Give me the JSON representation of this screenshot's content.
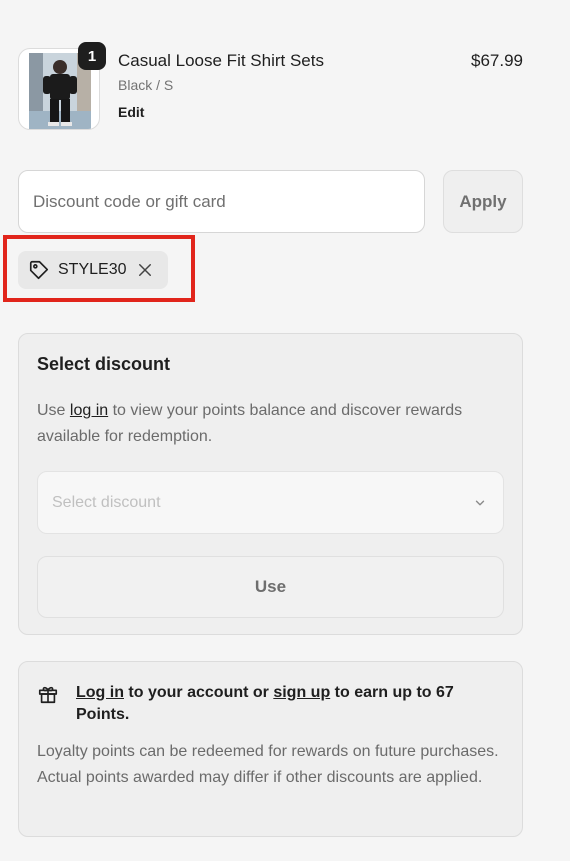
{
  "product": {
    "quantity": "1",
    "name": "Casual Loose Fit Shirt Sets",
    "variant": "Black / S",
    "edit_label": "Edit",
    "price": "$67.99"
  },
  "discount": {
    "placeholder": "Discount code or gift card",
    "apply_label": "Apply",
    "applied_code": "STYLE30"
  },
  "select_discount": {
    "title": "Select discount",
    "desc_before": "Use ",
    "desc_link": "log in",
    "desc_after": " to view your points balance and discover rewards available for redemption.",
    "select_placeholder": "Select discount",
    "use_label": "Use"
  },
  "loyalty": {
    "login_link": "Log in",
    "text_mid": " to your account or ",
    "signup_link": "sign up",
    "text_end": " to earn up to 67 Points.",
    "body": "Loyalty points can be redeemed for rewards on future purchases. Actual points awarded may differ if other discounts are applied."
  },
  "colors": {
    "highlight": "#e1251b",
    "background": "#f5f5f5",
    "badge": "#1e1e1e"
  },
  "icons": {
    "tag": "tag-icon",
    "remove": "close-icon",
    "chevron": "chevron-down-icon",
    "gift": "gift-icon"
  }
}
